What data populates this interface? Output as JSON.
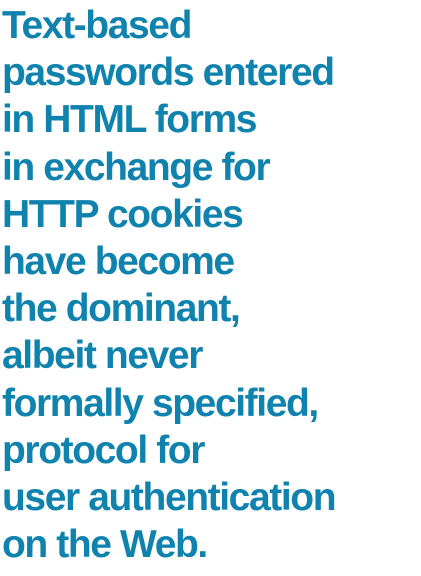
{
  "quote": {
    "lines": [
      "Text-based",
      "passwords entered",
      "in HTML forms",
      "in exchange for",
      "HTTP cookies",
      "have become",
      "the dominant,",
      "albeit never",
      "formally specified,",
      "protocol for",
      "user authentication",
      "on the Web."
    ],
    "color": "#0f83ad"
  }
}
